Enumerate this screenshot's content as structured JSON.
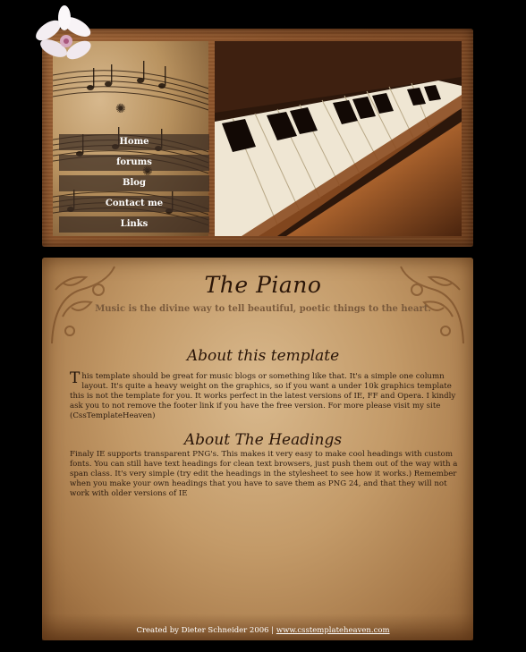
{
  "nav": {
    "items": [
      {
        "label": "Home"
      },
      {
        "label": "forums"
      },
      {
        "label": "Blog"
      },
      {
        "label": "Contact me"
      },
      {
        "label": "Links"
      }
    ]
  },
  "site": {
    "title": "The Piano",
    "tagline": "Music is the divine way to tell beautiful, poetic things to the heart."
  },
  "sections": [
    {
      "heading": "About this template",
      "dropcap": "T",
      "body": "his template should be great for music blogs or something like that. It's a simple one column layout. It's quite a heavy weight on the graphics, so if you want a under 10k graphics template this is not the template for you. It works perfect in the latest versions of IE, FF and Opera. I kindly ask you to not remove the footer link if you have the free version. For more please visit my site (CssTemplateHeaven)"
    },
    {
      "heading": "About The Headings",
      "body": "Finaly IE supports transparent PNG's. This makes it very easy to make cool headings with custom fonts. You can still have text headings for clean text browsers, just push them out of the way with a span class. It's very simple (try edit the headings in the stylesheet to see how it works.) Remember when you make your own headings that you have to save them as PNG 24, and that they will not work with older versions of IE"
    }
  ],
  "footer": {
    "credit": "Created by Dieter Schneider 2006 |",
    "link": "www.csstemplateheaven.com"
  },
  "colors": {
    "background": "#000000",
    "parchment": "#c39a68",
    "frame": "#8a522a",
    "nav_bar": "#3c2d23",
    "ink": "#2a1508"
  },
  "icons": {
    "flower": "magnolia-flower-icon",
    "swirl": "ornament-swirl-icon"
  }
}
